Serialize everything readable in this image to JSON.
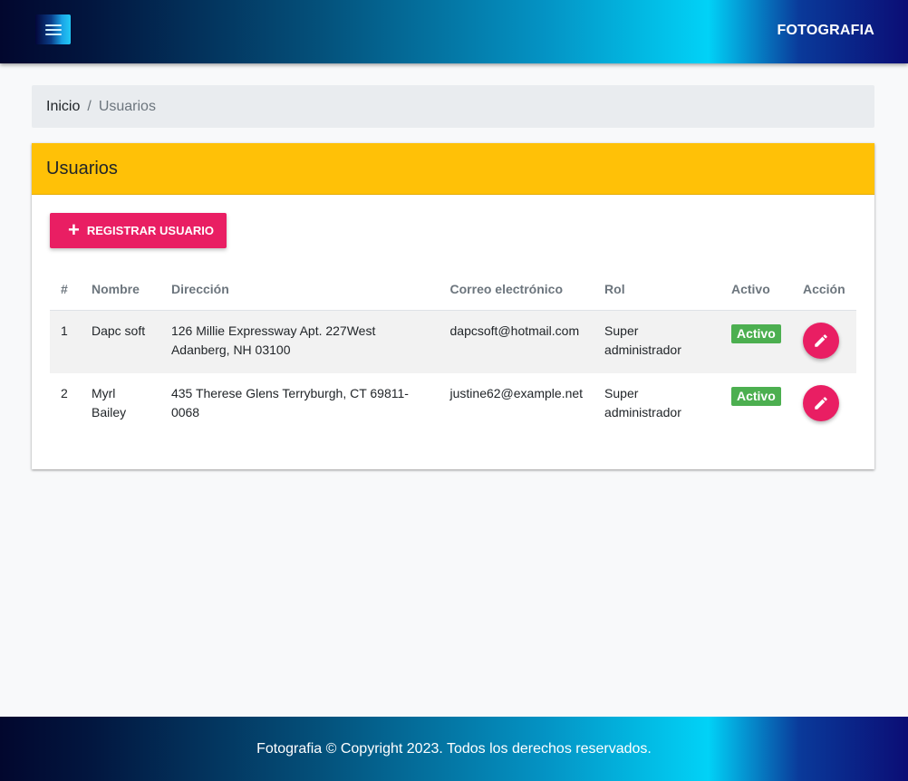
{
  "navbar": {
    "brand": "FOTOGRAFIA",
    "menu_icon": "hamburger-icon"
  },
  "breadcrumb": {
    "home": "Inicio",
    "separator": "/",
    "current": "Usuarios"
  },
  "card": {
    "title": "Usuarios",
    "register_button": "REGISTRAR USUARIO",
    "register_icon": "plus-icon",
    "header_color": "#ffc107"
  },
  "table": {
    "headers": [
      "#",
      "Nombre",
      "Dirección",
      "Correo electrónico",
      "Rol",
      "Activo",
      "Acción"
    ],
    "rows": [
      {
        "num": "1",
        "nombre": "Dapc soft",
        "direccion": "126 Millie Expressway Apt. 227West Adanberg, NH 03100",
        "correo": "dapcsoft@hotmail.com",
        "rol": "Super administrador",
        "activo": "Activo",
        "accion_icon": "pencil-icon"
      },
      {
        "num": "2",
        "nombre": "Myrl Bailey",
        "direccion": "435 Therese Glens Terryburgh, CT 69811-0068",
        "correo": "justine62@example.net",
        "rol": "Super administrador",
        "activo": "Activo",
        "accion_icon": "pencil-icon"
      }
    ]
  },
  "footer": {
    "text": "Fotografia © Copyright 2023. Todos los derechos reservados."
  },
  "colors": {
    "accent": "#e91e63",
    "active_badge": "#4caf50",
    "card_header": "#ffc107"
  }
}
